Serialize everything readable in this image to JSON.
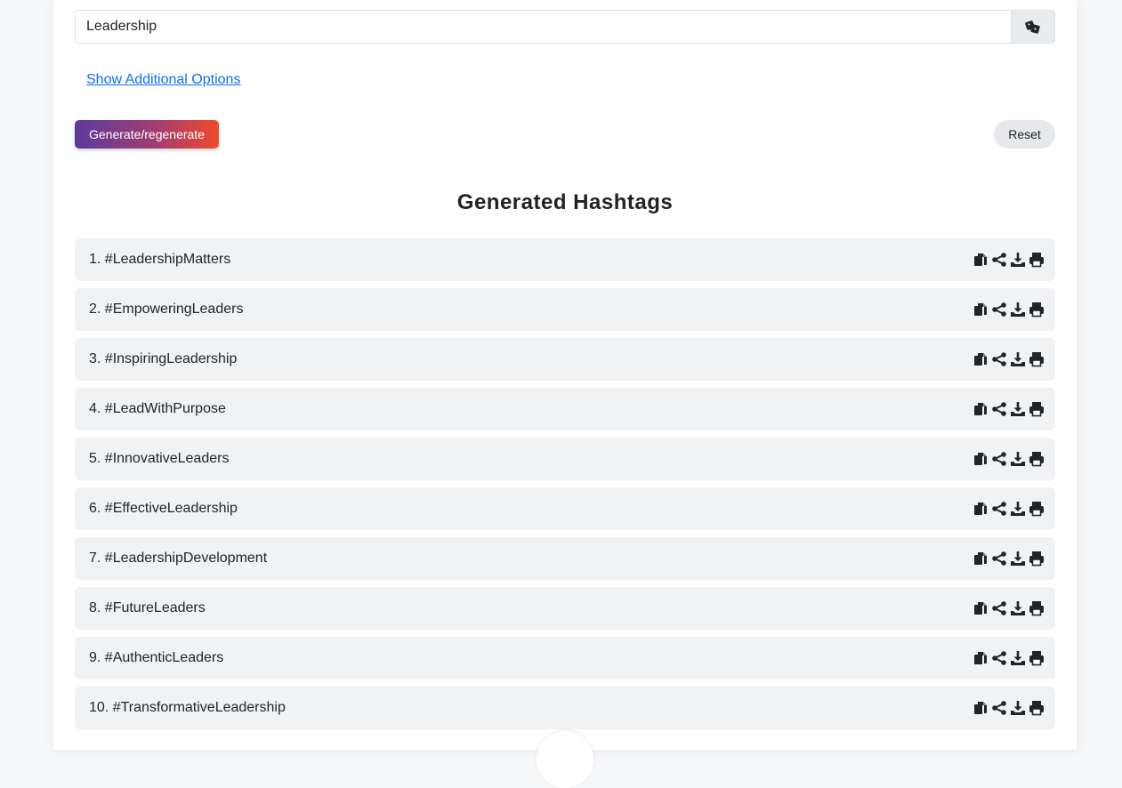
{
  "input": {
    "value": "Leadership"
  },
  "options_link": "Show Additional Options",
  "buttons": {
    "generate": "Generate/regenerate",
    "reset": "Reset"
  },
  "results": {
    "title": "Generated Hashtags",
    "items": [
      "1. #LeadershipMatters",
      "2. #EmpoweringLeaders",
      "3. #InspiringLeadership",
      "4. #LeadWithPurpose",
      "5. #InnovativeLeaders",
      "6. #EffectiveLeadership",
      "7. #LeadershipDevelopment",
      "8. #FutureLeaders",
      "9. #AuthenticLeaders",
      "10. #TransformativeLeadership"
    ],
    "item_icons": [
      "copy-icon",
      "share-icon",
      "download-icon",
      "print-icon"
    ]
  },
  "colors": {
    "accent_start": "#5b3a9c",
    "accent_end": "#f04a2c",
    "link": "#0d6efd",
    "item_bg": "#f1f2f4"
  }
}
